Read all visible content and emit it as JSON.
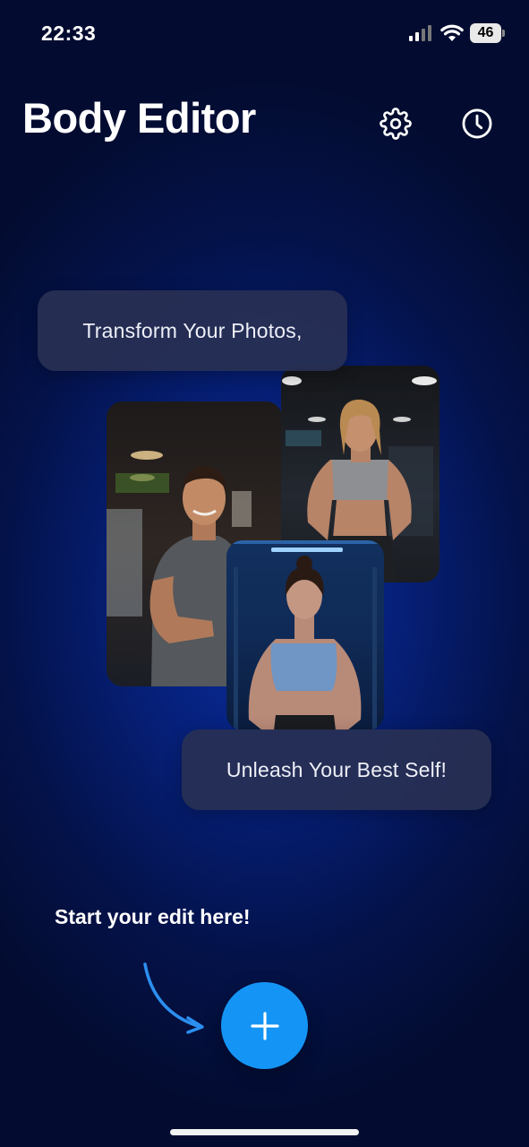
{
  "status_bar": {
    "time": "22:33",
    "battery_level": "46",
    "icons": [
      "signal-icon",
      "wifi-icon",
      "battery-icon"
    ]
  },
  "header": {
    "title": "Body Editor",
    "icons": [
      "gear-icon",
      "history-icon"
    ]
  },
  "hero": {
    "bubble_top": "Transform Your Photos,",
    "bubble_bottom": "Unleash Your Best Self!",
    "photos": [
      "man-gym-photo",
      "woman-gym-photo",
      "woman-gym-photo-2"
    ]
  },
  "cta": {
    "label": "Start your edit here!",
    "icons": [
      "curved-arrow-icon",
      "plus-icon"
    ]
  },
  "colors": {
    "accent": "#1495f5",
    "background": "#04124a",
    "bubble": "#283054"
  }
}
